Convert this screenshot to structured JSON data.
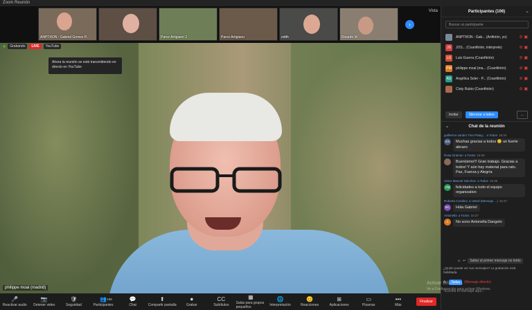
{
  "window": {
    "title": "Zoom Reunión"
  },
  "strip": {
    "view_label": "Vista",
    "tiles": [
      {
        "name": "ANPTRON - Gabriel Gomez P...",
        "bg": "#7a6a5a"
      },
      {
        "name": "",
        "bg": "#5e4f45"
      },
      {
        "name": "Parce Artigiano 2",
        "bg": "#6e7e56"
      },
      {
        "name": "Parce Artigiano",
        "bg": "#6b5a4a"
      },
      {
        "name": "edith",
        "bg": "#4a4a48"
      },
      {
        "name": "Ricardo M",
        "bg": "#8a7e70"
      }
    ]
  },
  "stage": {
    "badge_protected": "Grabando",
    "live_label": "LIVE",
    "youtube_label": "YouTube",
    "tooltip": "Ahora la reunión se está transmitiendo en directo en YouTube",
    "self_name": "philippe moal (madrid)"
  },
  "toolbar": {
    "items": [
      {
        "icon": "🎤",
        "label": "Reactivar audio",
        "name": "unmute-audio-button"
      },
      {
        "icon": "📷",
        "label": "Detener video",
        "name": "stop-video-button"
      },
      {
        "icon": "🛡",
        "label": "Seguridad",
        "name": "security-button"
      },
      {
        "icon": "👥",
        "label": "Participantes",
        "name": "participants-button"
      },
      {
        "icon": "💬",
        "label": "Chat",
        "name": "chat-button"
      },
      {
        "icon": "⬆",
        "label": "Compartir pantalla",
        "name": "share-screen-button"
      },
      {
        "icon": "⏺",
        "label": "Grabar",
        "name": "record-button"
      },
      {
        "icon": "CC",
        "label": "Subtítulos",
        "name": "captions-button"
      },
      {
        "icon": "▦",
        "label": "Salas para grupos pequeños",
        "name": "breakout-rooms-button"
      },
      {
        "icon": "🌐",
        "label": "Interpretación",
        "name": "interpretation-button"
      },
      {
        "icon": "😊",
        "label": "Reacciones",
        "name": "reactions-button"
      },
      {
        "icon": "⊞",
        "label": "Aplicaciones",
        "name": "apps-button"
      },
      {
        "icon": "▭",
        "label": "Pizarras",
        "name": "whiteboards-button"
      },
      {
        "icon": "•••",
        "label": "Más",
        "name": "more-button"
      }
    ],
    "participants_count": "106",
    "end_label": "Finalizar"
  },
  "participants": {
    "title": "Participantes (106)",
    "search_placeholder": "Buscar un participante",
    "rows": [
      {
        "initials": "",
        "color": "#7a8a9a",
        "name": "ANPTRON - Gab... (Anfitrión, yo)"
      },
      {
        "initials": "JS",
        "color": "#d04040",
        "name": "JOS... (Coanfitrión, intérprete)"
      },
      {
        "initials": "LG",
        "color": "#d05030",
        "name": "Luis Guerra (Coanfitrión)"
      },
      {
        "initials": "PM",
        "color": "#e07a20",
        "name": "philippe moal (ma... (Coanfitrión)"
      },
      {
        "initials": "AS",
        "color": "#2a9a8a",
        "name": "Angélica Soler - P... (Coanfitrión)"
      },
      {
        "initials": "",
        "color": "#aa6a4a",
        "name": "Cloty Rubio (Coanfitrión)"
      }
    ],
    "invite_label": "Invitar",
    "mute_all_label": "Silenciar a todos",
    "more_label": "..."
  },
  "chat": {
    "title": "Chat de la reunión",
    "messages": [
      {
        "from": "guillermo sandro Toia Pateg...",
        "to": "a Todos",
        "time": "15:34",
        "initials": "GS",
        "color": "#4a5a7a",
        "text": "Muchas gracias a todos 😊 un fuerte abrazo"
      },
      {
        "from": "Rosa Grainan",
        "to": "a Todos",
        "time": "15:36",
        "initials": "",
        "color": "#8a6a5a",
        "text": "Buenísimo!!! Gran trabajo. Gracias a todos! Y aún hay material para rato. Paz, Fuerza y Alegría"
      },
      {
        "from": "Victor Manuel Sánchez",
        "to": "a Todos",
        "time": "15:36",
        "initials": "VM",
        "color": "#2a9a5a",
        "text": "felicidades a todo el equipo organizativo"
      },
      {
        "from": "Roberta Condino",
        "to": "a Usted (Mensaje ...)",
        "time": "15:37",
        "initials": "RC",
        "color": "#7a4ab0",
        "text": "Hola Gabriel"
      },
      {
        "from": "Antonella",
        "to": "a Todos",
        "time": "15:37",
        "initials": "A",
        "color": "#e07a20",
        "text": "No sono Antonella Dangelo"
      }
    ],
    "jump_label": "Saltar al primer mensaje no leído",
    "notice": "¿Quién puede ver sus mensajes? La grabación está habilitada.",
    "to_label": "A:",
    "to_value": "Todos",
    "direct_label": "(Mensaje directo)",
    "input_placeholder": "Escribir el mensaje aquí..."
  },
  "watermark": {
    "line1": "Activar Windows",
    "line2": "Ve a Configuración para activar Windows."
  }
}
